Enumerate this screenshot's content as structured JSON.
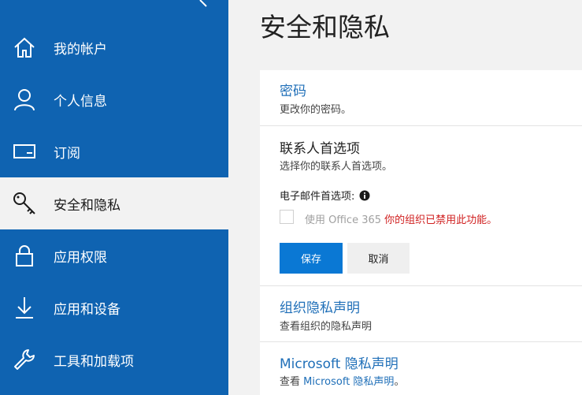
{
  "sidebar": {
    "items": [
      {
        "label": "我的帐户",
        "icon": "home-icon"
      },
      {
        "label": "个人信息",
        "icon": "person-icon"
      },
      {
        "label": "订阅",
        "icon": "card-icon"
      },
      {
        "label": "安全和隐私",
        "icon": "key-icon",
        "active": true
      },
      {
        "label": "应用权限",
        "icon": "lock-icon"
      },
      {
        "label": "应用和设备",
        "icon": "download-icon"
      },
      {
        "label": "工具和加载项",
        "icon": "wrench-icon"
      }
    ]
  },
  "page": {
    "title": "安全和隐私"
  },
  "password": {
    "title": "密码",
    "desc": "更改你的密码。"
  },
  "contact": {
    "title": "联系人首选项",
    "desc": "选择你的联系人首选项。",
    "email_label": "电子邮件首选项:",
    "checkbox_text": "使用 Office 365",
    "disabled_warning": "你的组织已禁用此功能。",
    "save_label": "保存",
    "cancel_label": "取消"
  },
  "org_privacy": {
    "title": "组织隐私声明",
    "desc": "查看组织的隐私声明"
  },
  "ms_privacy": {
    "title": "Microsoft 隐私声明",
    "desc_prefix": "查看 ",
    "desc_link": "Microsoft 隐私声明",
    "desc_suffix": "。"
  },
  "colors": {
    "accent": "#0f63b1",
    "button": "#0a78d4",
    "warning": "#d02020",
    "link": "#1f6fb8"
  }
}
